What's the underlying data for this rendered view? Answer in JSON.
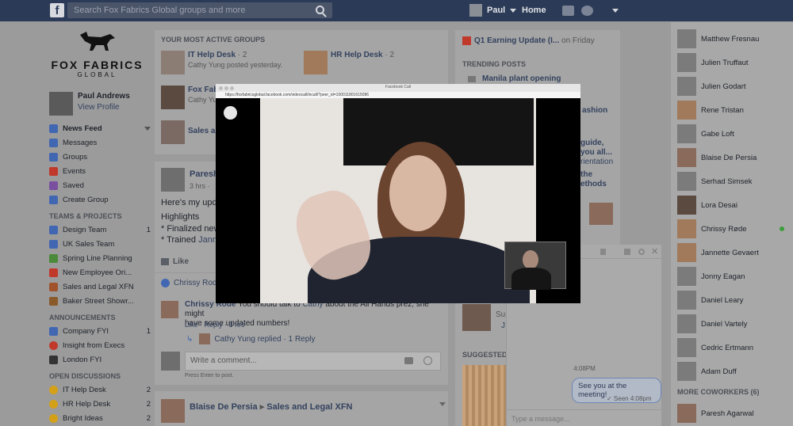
{
  "topbar": {
    "logo": "f",
    "search_placeholder": "Search Fox Fabrics Global groups and more",
    "user_name": "Paul",
    "home_label": "Home"
  },
  "brand": {
    "name": "FOX FABRICS",
    "sub": "GLOBAL"
  },
  "profile": {
    "name": "Paul Andrews",
    "link": "View Profile"
  },
  "nav_main": [
    {
      "label": "News Feed",
      "count": ""
    },
    {
      "label": "Messages",
      "count": ""
    },
    {
      "label": "Groups",
      "count": ""
    },
    {
      "label": "Events",
      "count": ""
    },
    {
      "label": "Saved",
      "count": ""
    },
    {
      "label": "Create Group",
      "count": ""
    }
  ],
  "teams_heading": "TEAMS & PROJECTS",
  "teams": [
    {
      "label": "Design Team",
      "count": "1"
    },
    {
      "label": "UK Sales Team",
      "count": ""
    },
    {
      "label": "Spring Line Planning",
      "count": ""
    },
    {
      "label": "New Employee Ori...",
      "count": ""
    },
    {
      "label": "Sales and Legal XFN",
      "count": ""
    },
    {
      "label": "Baker Street Showr...",
      "count": ""
    }
  ],
  "announcements_heading": "ANNOUNCEMENTS",
  "announcements": [
    {
      "label": "Company FYI",
      "count": "1"
    },
    {
      "label": "Insight from Execs",
      "count": ""
    },
    {
      "label": "London FYI",
      "count": ""
    }
  ],
  "discussions_heading": "OPEN DISCUSSIONS",
  "discussions": [
    {
      "label": "IT Help Desk",
      "count": "2"
    },
    {
      "label": "HR Help Desk",
      "count": "2"
    },
    {
      "label": "Bright Ideas",
      "count": "2"
    }
  ],
  "active_groups": {
    "title": "YOUR MOST ACTIVE GROUPS",
    "g1_name": "IT Help Desk",
    "g1_count": "· 2",
    "g1_meta": "Cathy Yung posted yesterday.",
    "g2_name": "HR Help Desk",
    "g2_count": "· 2",
    "g3_name": "Fox Fab",
    "g3_meta": "Cathy Yu",
    "g4_name": "Sales an"
  },
  "post": {
    "author": "Paresh",
    "time": "3 hrs · ",
    "line1": "Here's my upd",
    "line2": "Highlights",
    "line3": "* Finalized new",
    "line4_pre": "* Trained ",
    "line4_link": "Janne",
    "like": "Like",
    "liked_by": "Chrissy Rode"
  },
  "comment": {
    "author": "Chrissy Rode",
    "text_pre": " You should talk to ",
    "text_link": "Cathy",
    "text_post": " about the All Hands prez, she might",
    "text_line2": "have some updated numbers!",
    "actions": "Like · Reply · 3 hrs",
    "reply_author": "Cathy Yung replied",
    "reply_count": "· 1 Reply"
  },
  "composer": {
    "placeholder": "Write a comment...",
    "hint": "Press Enter to post."
  },
  "post2": {
    "author": "Blaise De Persia",
    "arrow": "▸",
    "group": "Sales and Legal XFN"
  },
  "events": {
    "item": "Q1 Earning Update (I...",
    "suffix": "on Friday"
  },
  "trending": {
    "title": "TRENDING POSTS",
    "t1": "Manila plant opening",
    "t2": "ashion",
    "t3": "guide,",
    "t4": "you all...",
    "t5": "rientation",
    "t6": "the",
    "t7": "ethods",
    "sug": "SUGGESTED G",
    "sup": "Sup",
    "j": "J"
  },
  "video_call": {
    "window_title": "Facebook Call",
    "url": "https://foxfabricsglobal.facebook.com/videocall/incall/?peer_id=100011801615086"
  },
  "chat": {
    "time": "4:08PM",
    "message": "See you at the meeting!",
    "seen": "✓ Seen 4:08pm",
    "placeholder": "Type a message..."
  },
  "contacts": [
    "Matthew Fresnau",
    "Julien Truffaut",
    "Julien Godart",
    "Rene Tristan",
    "Gabe Loft",
    "Blaise De Persia",
    "Serhad Simsek",
    "Lora Desai",
    "Chrissy Røde",
    "Jannette Gevaert",
    "Jonny Eagan",
    "Daniel Leary",
    "Daniel Vartely",
    "Cedric Ertmann",
    "Adam Duff"
  ],
  "more_coworkers": "MORE COWORKERS (6)",
  "more_contact": "Paresh Agarwal",
  "colors": {
    "topbar": "#2b3a56",
    "link": "#33425e",
    "online": "#3a9e3a",
    "accent": "#4267b2"
  }
}
